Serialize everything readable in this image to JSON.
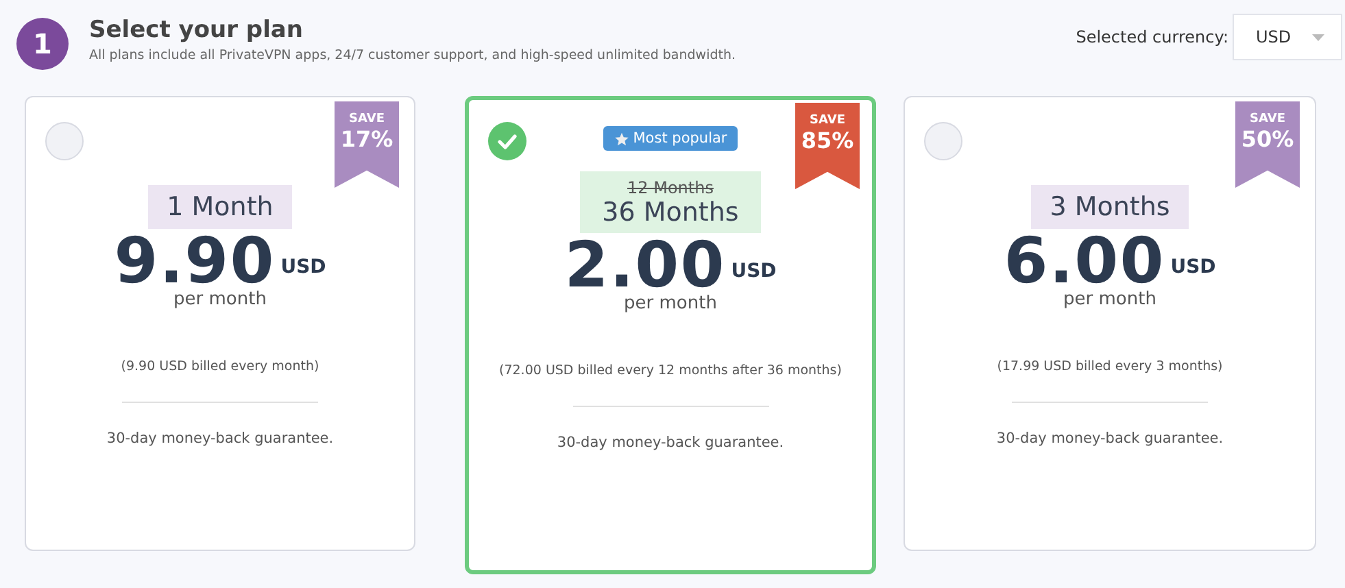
{
  "step": {
    "number": "1",
    "title": "Select your plan",
    "subtitle": "All plans include all PrivateVPN apps, 24/7 customer support, and high-speed unlimited bandwidth."
  },
  "currency": {
    "label": "Selected currency:",
    "value": "USD"
  },
  "plans": [
    {
      "selected": false,
      "save_label": "SAVE",
      "save_value": "17%",
      "duration": "1 Month",
      "price": "9.90",
      "currency": "USD",
      "per": "per month",
      "billed": "(9.90 USD billed every month)",
      "guarantee": "30-day money-back guarantee."
    },
    {
      "selected": true,
      "badge": "Most popular",
      "save_label": "SAVE",
      "save_value": "85%",
      "old_duration": "12 Months",
      "duration": "36 Months",
      "price": "2.00",
      "currency": "USD",
      "per": "per month",
      "billed": "(72.00 USD billed every 12 months after 36 months)",
      "guarantee": "30-day money-back guarantee."
    },
    {
      "selected": false,
      "save_label": "SAVE",
      "save_value": "50%",
      "duration": "3 Months",
      "price": "6.00",
      "currency": "USD",
      "per": "per month",
      "billed": "(17.99 USD billed every 3 months)",
      "guarantee": "30-day money-back guarantee."
    }
  ]
}
